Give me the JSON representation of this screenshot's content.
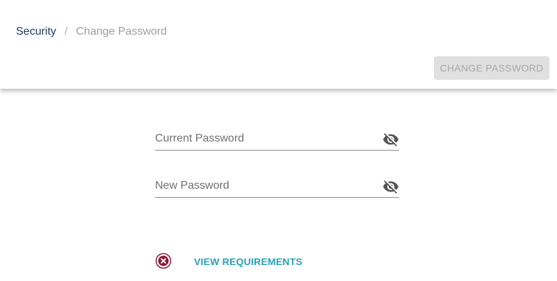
{
  "breadcrumb": {
    "root": "Security",
    "separator": "/",
    "current": "Change Password"
  },
  "header": {
    "change_button_label": "CHANGE PASSWORD"
  },
  "form": {
    "current_password": {
      "placeholder": "Current Password",
      "value": "",
      "icon": "eye-off-icon"
    },
    "new_password": {
      "placeholder": "New Password",
      "value": "",
      "icon": "eye-off-icon"
    }
  },
  "requirements": {
    "status_icon": "error-circle-icon",
    "link_label": "VIEW REQUIREMENTS"
  },
  "colors": {
    "breadcrumb_root": "#1e3a5f",
    "accent_link": "#2aa0b5",
    "error": "#8b1a3a",
    "disabled_button_bg": "#e0e0e0"
  }
}
